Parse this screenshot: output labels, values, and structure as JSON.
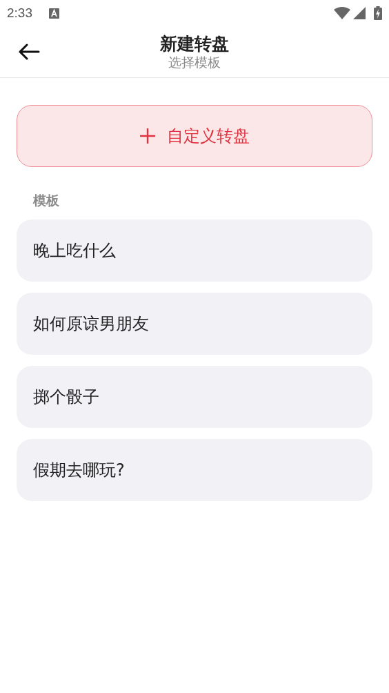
{
  "status_bar": {
    "time": "2:33"
  },
  "header": {
    "title": "新建转盘",
    "subtitle": "选择模板"
  },
  "custom_button": {
    "label": "自定义转盘"
  },
  "section": {
    "label": "模板"
  },
  "templates": [
    {
      "label": "晚上吃什么"
    },
    {
      "label": "如何原谅男朋友"
    },
    {
      "label": "掷个骰子"
    },
    {
      "label": "假期去哪玩?"
    }
  ]
}
